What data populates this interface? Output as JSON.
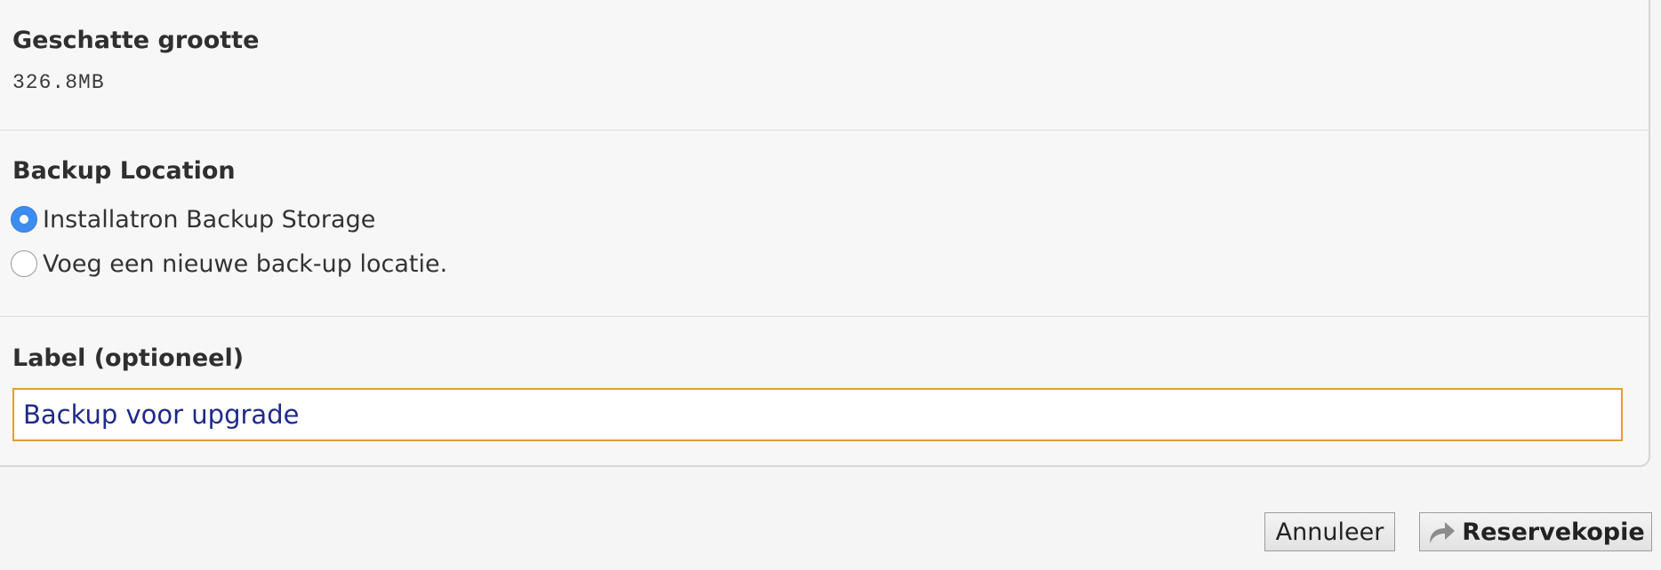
{
  "estimated_size": {
    "heading": "Geschatte grootte",
    "value": "326.8MB"
  },
  "backup_location": {
    "heading": "Backup Location",
    "options": [
      {
        "label": "Installatron Backup Storage",
        "checked": true
      },
      {
        "label": "Voeg een nieuwe back-up locatie.",
        "checked": false
      }
    ]
  },
  "label_field": {
    "heading": "Label (optioneel)",
    "value": "Backup voor upgrade"
  },
  "actions": {
    "cancel_label": "Annuleer",
    "backup_label": "Reservekopie",
    "backup_icon": "share-arrow-icon"
  },
  "colors": {
    "radio_checked": "#3d8df0",
    "input_border_focus": "#e59d34",
    "input_text": "#1f2a8a"
  }
}
